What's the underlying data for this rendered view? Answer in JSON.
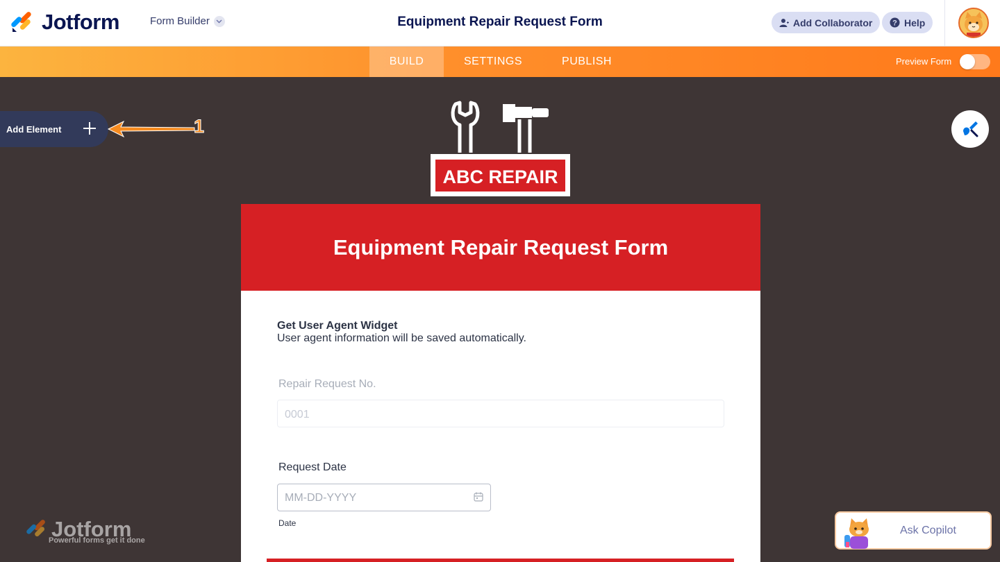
{
  "topbar": {
    "brand": "Jotform",
    "builder_label": "Form Builder",
    "title": "Equipment Repair Request Form",
    "add_collaborator": "Add Collaborator",
    "help": "Help"
  },
  "nav": {
    "tabs": [
      {
        "label": "BUILD",
        "active": true
      },
      {
        "label": "SETTINGS",
        "active": false
      },
      {
        "label": "PUBLISH",
        "active": false
      }
    ],
    "preview_label": "Preview Form",
    "preview_on": false
  },
  "sidebar": {
    "add_element": "Add Element",
    "callout_number": "1"
  },
  "brand_logo": {
    "text": "ABC REPAIR"
  },
  "form": {
    "header_title": "Equipment Repair Request Form",
    "widget": {
      "title": "Get User Agent Widget",
      "description": "User agent information will be saved automatically."
    },
    "repair_no": {
      "label": "Repair Request No.",
      "placeholder": "0001"
    },
    "request_date": {
      "label": "Request Date",
      "placeholder": "MM-DD-YYYY",
      "sublabel": "Date"
    }
  },
  "watermark": {
    "brand": "Jotform",
    "tagline": "Powerful forms get it done"
  },
  "copilot": {
    "label": "Ask Copilot"
  },
  "colors": {
    "brand_navy": "#0a1551",
    "form_red": "#d62024",
    "canvas_bg": "#3e3535",
    "nav_orange": "#ff7a1b",
    "callout_orange": "#f68b1f"
  },
  "icons": [
    "jotform-logo-icon",
    "chevron-down-icon",
    "add-user-icon",
    "help-icon",
    "avatar",
    "plus-icon",
    "arrow-icon",
    "designer-icon",
    "calendar-icon",
    "copilot-cat-icon"
  ]
}
